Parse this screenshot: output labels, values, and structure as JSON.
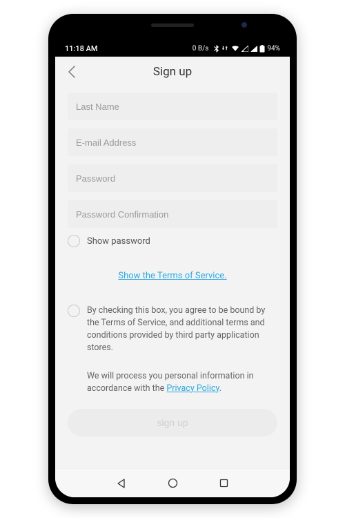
{
  "statusbar": {
    "time": "11:18 AM",
    "speed": "0 B/s",
    "battery": "94%"
  },
  "header": {
    "title": "Sign up"
  },
  "form": {
    "lastname_placeholder": "Last Name",
    "email_placeholder": "E-mail Address",
    "password_placeholder": "Password",
    "password_conf_placeholder": "Password Confirmation",
    "show_password_label": "Show password",
    "terms_link": "Show the Terms of Service.",
    "agree_text": "By checking this box, you agree to be bound by the Terms of Service, and additional terms and conditions provided by third party application stores.",
    "privacy_prefix": "We will process you personal information in accordance with the ",
    "privacy_link": "Privacy Policy",
    "privacy_suffix": ".",
    "signup_button": "sign up"
  }
}
